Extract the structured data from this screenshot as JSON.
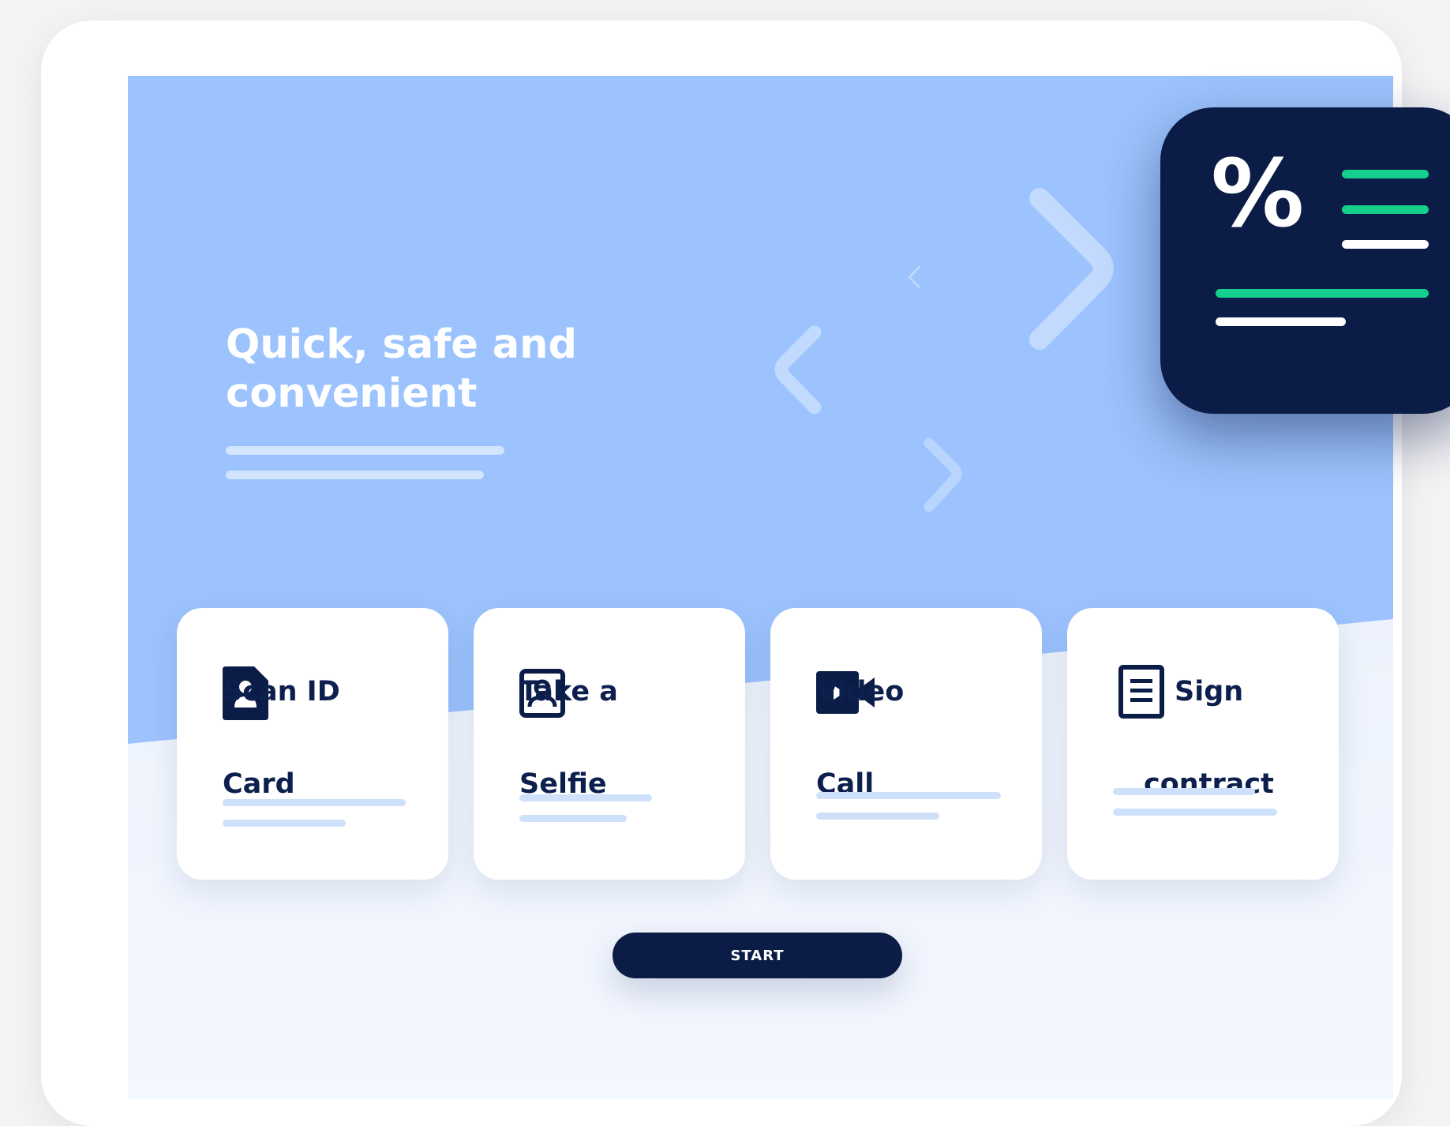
{
  "hero": {
    "headline": "Quick, safe and convenient"
  },
  "cards": [
    {
      "line1": "Scan ID",
      "line2": "Card",
      "icon": "id-card-icon"
    },
    {
      "line1": "Take a",
      "line2": "Selfie",
      "icon": "selfie-icon"
    },
    {
      "line1": "Video",
      "line2": "Call",
      "icon": "video-camera-icon"
    },
    {
      "line1": "Sign",
      "line2": "contract",
      "icon": "document-icon"
    }
  ],
  "start_button": {
    "label": "START"
  },
  "badge": {
    "symbol": "%",
    "icon": "percent-document-icon"
  },
  "colors": {
    "hero_blue": "#9cc3fd",
    "navy": "#0b1c46",
    "green": "#15d08d",
    "light_bar": "#cfe0fb"
  }
}
